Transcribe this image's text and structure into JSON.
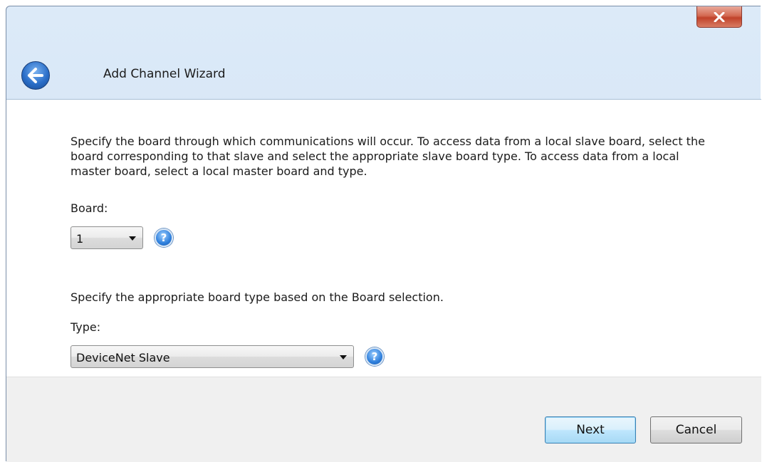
{
  "window": {
    "title": "Add Channel Wizard"
  },
  "intro_text": "Specify the board through which communications will occur. To access data from a local slave board, select the board corresponding to that slave and select the appropriate slave board type. To access data from a local master board, select a local master board and type.",
  "board": {
    "label": "Board:",
    "value": "1",
    "help_icon": "question-mark-icon"
  },
  "type_intro_text": "Specify the appropriate board type based on the Board selection.",
  "type": {
    "label": "Type:",
    "value": "DeviceNet Slave",
    "help_icon": "question-mark-icon"
  },
  "buttons": {
    "next": "Next",
    "cancel": "Cancel"
  },
  "colors": {
    "close_button": "#c0422a",
    "default_button_border": "#3c7fb1",
    "help_icon": "#2e7fdc"
  }
}
